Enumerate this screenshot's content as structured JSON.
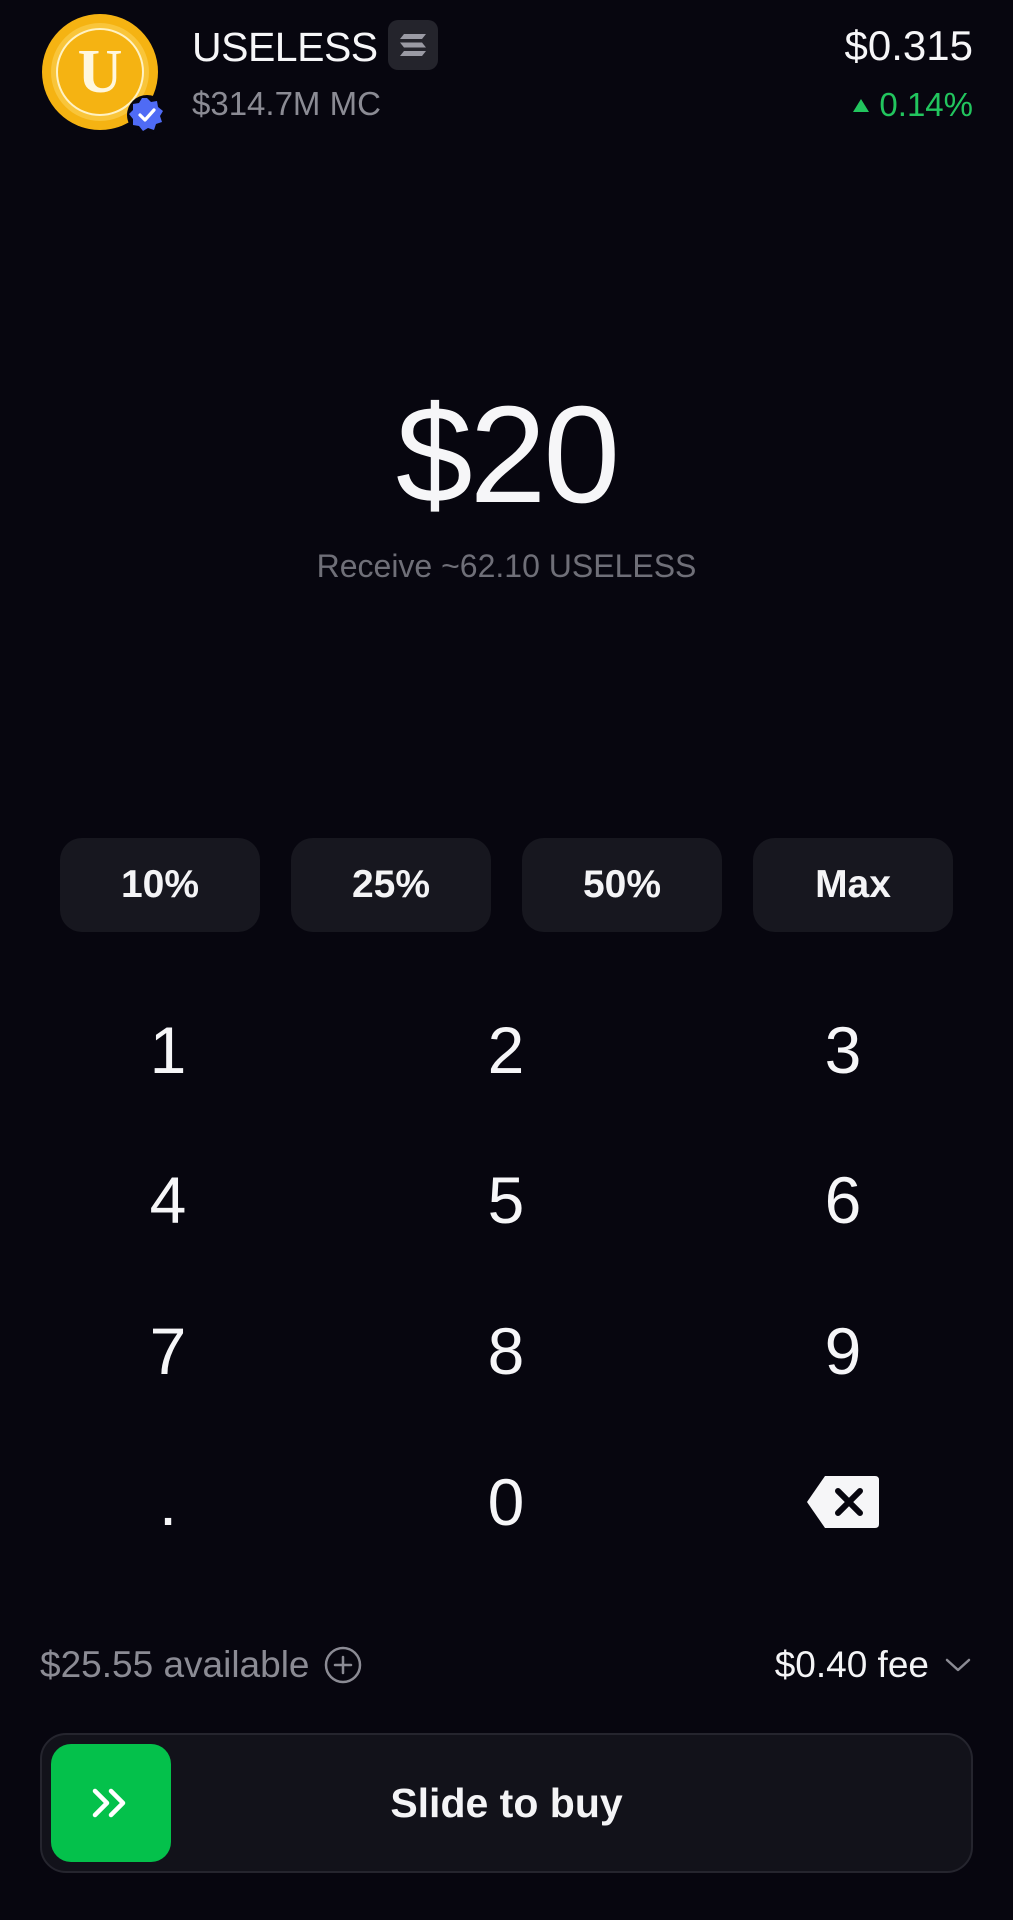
{
  "token": {
    "name": "USELESS",
    "logo_letter": "U",
    "market_cap": "$314.7M MC",
    "price": "$0.315",
    "change": "0.14%"
  },
  "order": {
    "amount": "$20",
    "receive": "Receive ~62.10 USELESS"
  },
  "quick_amounts": [
    "10%",
    "25%",
    "50%",
    "Max"
  ],
  "keypad": {
    "keys": [
      "1",
      "2",
      "3",
      "4",
      "5",
      "6",
      "7",
      "8",
      "9",
      ".",
      "0"
    ],
    "backspace_icon": "backspace-icon"
  },
  "footer": {
    "available": "$25.55 available",
    "fee": "$0.40 fee",
    "slide_label": "Slide to buy"
  },
  "colors": {
    "background": "#07060f",
    "accent_green": "#04c14b",
    "positive": "#22c55e",
    "verified_blue": "#4f6bf5",
    "logo_gold": "#f5b312"
  }
}
